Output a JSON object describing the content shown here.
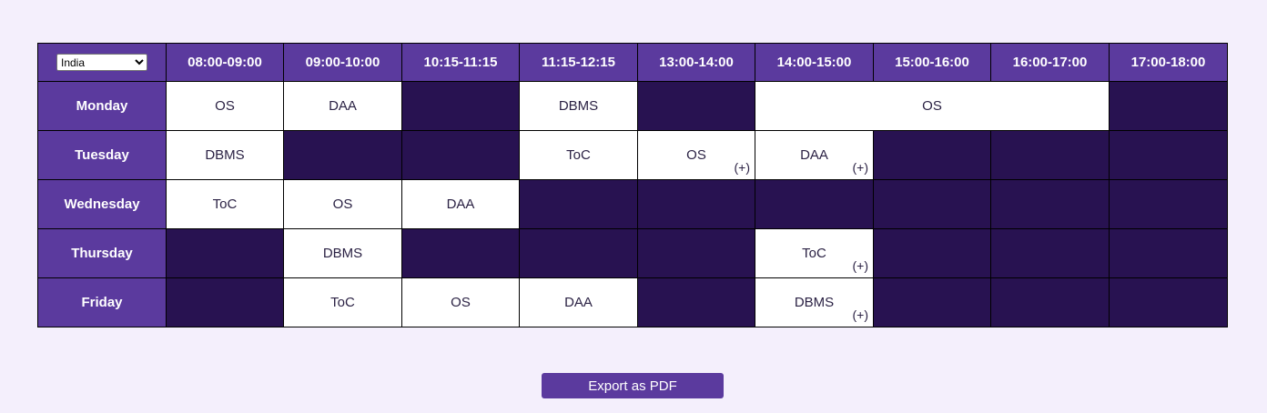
{
  "country_select": {
    "selected": "India",
    "options": [
      "India"
    ]
  },
  "time_slots": [
    "08:00-09:00",
    "09:00-10:00",
    "10:15-11:15",
    "11:15-12:15",
    "13:00-14:00",
    "14:00-15:00",
    "15:00-16:00",
    "16:00-17:00",
    "17:00-18:00"
  ],
  "days": [
    "Monday",
    "Tuesday",
    "Wednesday",
    "Thursday",
    "Friday"
  ],
  "schedule": {
    "Monday": {
      "08:00-09:00": "OS",
      "09:00-10:00": "DAA",
      "11:15-12:15": "DBMS",
      "14:00-17:00": "OS"
    },
    "Tuesday": {
      "08:00-09:00": "DBMS",
      "11:15-12:15": "ToC",
      "13:00-14:00": "OS",
      "14:00-15:00": "DAA"
    },
    "Wednesday": {
      "08:00-09:00": "ToC",
      "09:00-10:00": "OS",
      "10:15-11:15": "DAA"
    },
    "Thursday": {
      "09:00-10:00": "DBMS",
      "14:00-15:00": "ToC"
    },
    "Friday": {
      "09:00-10:00": "ToC",
      "10:15-11:15": "OS",
      "11:15-12:15": "DAA",
      "14:00-15:00": "DBMS"
    }
  },
  "extra_marker": "(+)",
  "export_button_label": "Export as PDF",
  "colors": {
    "header_bg": "#5b3a9e",
    "empty_slot": "#281251",
    "filled_slot": "#ffffff",
    "page_bg": "#f4effc"
  }
}
